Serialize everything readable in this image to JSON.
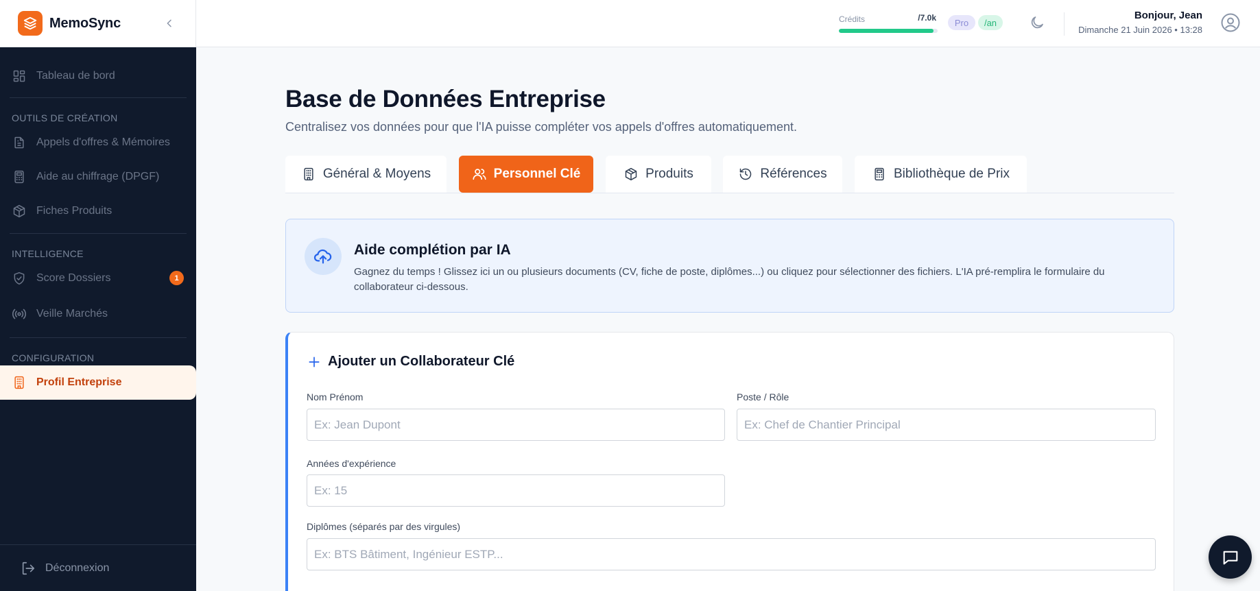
{
  "app": {
    "name": "MemoSync"
  },
  "sidebar": {
    "items": [
      {
        "label": "Tableau de bord"
      },
      {
        "label": "Appels d'offres & Mémoires"
      },
      {
        "label": "Aide au chiffrage (DPGF)"
      },
      {
        "label": "Fiches Produits"
      },
      {
        "label": "Score Dossiers",
        "badge": "1"
      },
      {
        "label": "Veille Marchés"
      },
      {
        "label": "Profil Entreprise"
      }
    ],
    "sections": {
      "creation": "OUTILS DE CRÉATION",
      "intelligence": "INTELLIGENCE",
      "configuration": "CONFIGURATION"
    },
    "logout_label": "Déconnexion"
  },
  "topbar": {
    "credits_label": "Crédits",
    "credits_value": "/7.0k",
    "credits_fraction": 0.96,
    "plan_badge": "Pro",
    "period_badge": "/an",
    "greeting": "Bonjour, Jean",
    "date": "Dimanche 21 Juin 2026 • 13:28"
  },
  "page": {
    "title": "Base de Données Entreprise",
    "subtitle": "Centralisez vos données pour que l'IA puisse compléter vos appels d'offres automatiquement."
  },
  "tabs": [
    {
      "label": "Général & Moyens",
      "icon": "building-icon"
    },
    {
      "label": "Personnel Clé",
      "icon": "users-icon",
      "active": true
    },
    {
      "label": "Produits",
      "icon": "package-icon"
    },
    {
      "label": "Références",
      "icon": "history-icon"
    },
    {
      "label": "Bibliothèque de Prix",
      "icon": "calculator-icon"
    }
  ],
  "ai_box": {
    "title": "Aide complétion par IA",
    "description": "Gagnez du temps ! Glissez ici un ou plusieurs documents (CV, fiche de poste, diplômes...) ou cliquez pour sélectionner des fichiers. L'IA pré-remplira le formulaire du collaborateur ci-dessous."
  },
  "form": {
    "title": "Ajouter un Collaborateur Clé",
    "fields": {
      "name": {
        "label": "Nom Prénom",
        "placeholder": "Ex: Jean Dupont"
      },
      "role": {
        "label": "Poste / Rôle",
        "placeholder": "Ex: Chef de Chantier Principal"
      },
      "experience": {
        "label": "Années d'expérience",
        "placeholder": "Ex: 15"
      },
      "diplomas": {
        "label": "Diplômes (séparés par des virgules)",
        "placeholder": "Ex: BTS Bâtiment, Ingénieur ESTP..."
      }
    }
  },
  "colors": {
    "accent": "#f06419",
    "sidebar_bg": "#101a2c",
    "info_border": "#3b82f6",
    "credits_bar": "#22c98a"
  }
}
